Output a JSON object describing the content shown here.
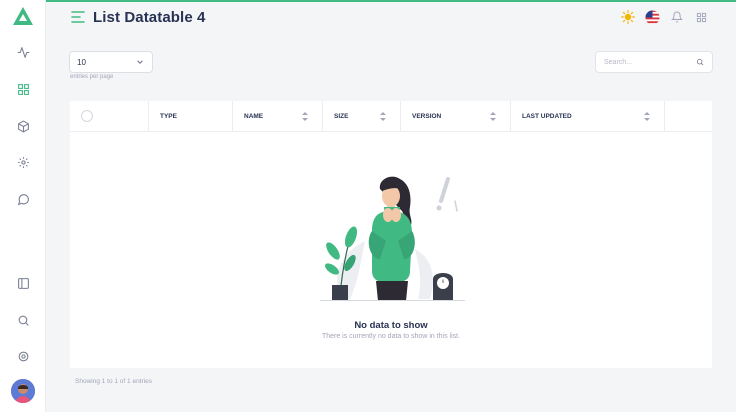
{
  "header": {
    "title": "List Datatable 4"
  },
  "sidebar": {
    "icons": [
      "activity-icon",
      "grid-icon",
      "box-icon",
      "settings-cog-icon",
      "message-circle-icon",
      "sidebar-panel-icon",
      "search-icon",
      "settings-icon"
    ]
  },
  "controls": {
    "entries_value": "10",
    "entries_hint": "entries per page",
    "search_placeholder": "Search..."
  },
  "table": {
    "columns": [
      "TYPE",
      "NAME",
      "SIZE",
      "VERSION",
      "LAST UPDATED"
    ]
  },
  "empty_state": {
    "title": "No data to show",
    "subtitle": "There is currently no data to show in this list."
  },
  "footer": {
    "summary": "Showing 1 to 1 of 1 entries"
  },
  "colors": {
    "accent": "#41b983",
    "text": "#283252",
    "muted": "#a2a5b9"
  }
}
